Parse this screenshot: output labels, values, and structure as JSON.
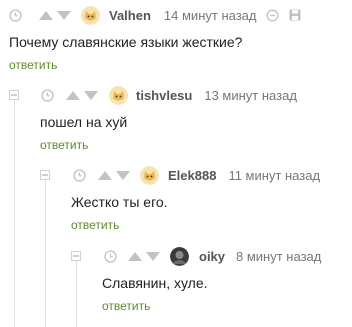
{
  "comments": [
    {
      "username": "Valhen",
      "time": "14 минут назад",
      "text": "Почему славянские языки жесткие?",
      "reply_label": "ответить",
      "avatar": "cat-avatar-icon"
    },
    {
      "username": "tishvlesu",
      "time": "13 минут назад",
      "text": "пошел на хуй",
      "reply_label": "ответить",
      "avatar": "cat-avatar-icon"
    },
    {
      "username": "Elek888",
      "time": "11 минут назад",
      "text": "Жестко ты его.",
      "reply_label": "ответить",
      "avatar": "cat-avatar-icon"
    },
    {
      "username": "oiky",
      "time": "8 минут назад",
      "text": "Славянин, хуле.",
      "reply_label": "ответить",
      "avatar": "photo-avatar"
    }
  ],
  "icons": {
    "clock": "clock-icon",
    "upvote": "upvote-arrow-icon",
    "downvote": "downvote-arrow-icon",
    "link": "link-icon",
    "save": "save-icon",
    "collapse": "collapse-thread-icon"
  },
  "colors": {
    "reply_link": "#5f8a2c",
    "icon_gray": "#c2c2c2",
    "username": "#555555"
  }
}
